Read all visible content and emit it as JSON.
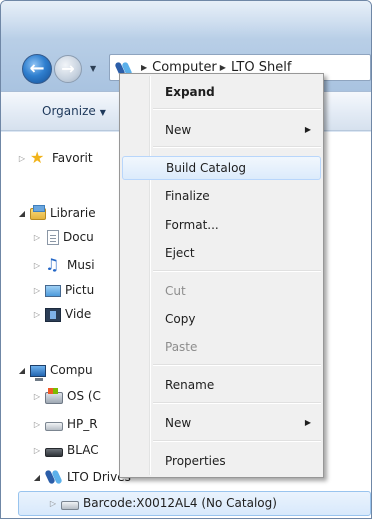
{
  "address_bar": {
    "breadcrumbs": [
      "Computer",
      "LTO Shelf"
    ],
    "root_icon": "tape-drive-icon"
  },
  "toolbar": {
    "organize_label": "Organize"
  },
  "nav_tree": {
    "favorites": "Favorit",
    "libraries": "Librarie",
    "documents": "Docu",
    "music": "Musi",
    "pictures": "Pictu",
    "videos": "Vide",
    "computer": "Compu",
    "os_drive": "OS (C",
    "hp_drive": "HP_R",
    "black_drive": "BLAC",
    "lto_drives": "LTO Drives",
    "barcode_tape": "Barcode:X0012AL4 (No Catalog)"
  },
  "context_menu": {
    "items": [
      {
        "label": "Expand",
        "bold": true
      },
      {
        "label": "New",
        "submenu": true
      },
      {
        "label": "Build Catalog",
        "highlighted": true
      },
      {
        "label": "Finalize"
      },
      {
        "label": "Format..."
      },
      {
        "label": "Eject"
      },
      {
        "label": "Cut",
        "disabled": true
      },
      {
        "label": "Copy"
      },
      {
        "label": "Paste",
        "disabled": true
      },
      {
        "label": "Rename"
      },
      {
        "label": "New",
        "submenu": true
      },
      {
        "label": "Properties"
      }
    ]
  },
  "icons": {
    "back": "back-arrow-icon",
    "forward": "forward-arrow-icon",
    "favorites": "star-icon",
    "libraries": "library-icon",
    "documents": "document-icon",
    "music": "music-note-icon",
    "pictures": "picture-icon",
    "videos": "video-icon",
    "computer": "computer-icon",
    "drive": "drive-icon",
    "tape": "tape-drive-icon"
  },
  "colors": {
    "menu_highlight": "#dcebfb",
    "selection": "#d8e9fb",
    "disabled_text": "#8d8d8d"
  }
}
